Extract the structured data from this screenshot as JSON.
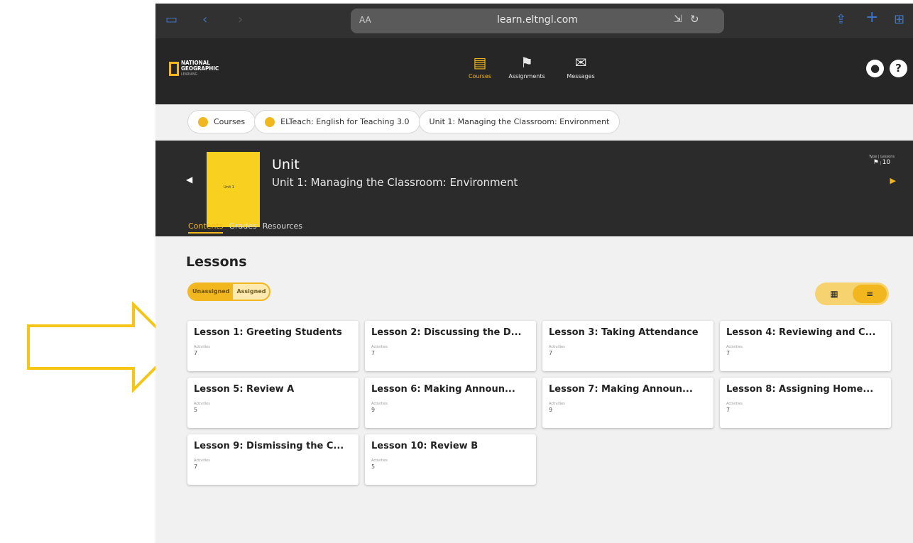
{
  "browser": {
    "url": "learn.eltngl.com",
    "aa_label": "AA"
  },
  "header": {
    "logo_line1": "NATIONAL",
    "logo_line2": "GEOGRAPHIC",
    "logo_line3": "LEARNING",
    "nav": [
      {
        "label": "Courses",
        "icon": "course-book-icon"
      },
      {
        "label": "Assignments",
        "icon": "assignment-flag-icon"
      },
      {
        "label": "Messages",
        "icon": "envelope-icon"
      }
    ],
    "accent": "#f2b71f"
  },
  "breadcrumb": {
    "items": [
      {
        "label": "Courses"
      },
      {
        "label": "ELTeach: English for Teaching 3.0"
      },
      {
        "label": "Unit 1: Managing the Classroom: Environment"
      }
    ]
  },
  "unit": {
    "type_label": "Unit",
    "title": "Unit 1: Managing the Classroom: Environment",
    "cover_text": "Unit 1",
    "meta_type_label": "Type",
    "meta_lessons_label": "Lessons",
    "meta_lessons_value": "10",
    "tabs": [
      "Contents",
      "Grades",
      "Resources"
    ]
  },
  "main": {
    "heading": "Lessons",
    "filter": [
      "Unassigned",
      "Assigned"
    ],
    "activities_label": "Activities",
    "lessons": [
      {
        "title": "Lesson 1: Greeting Students",
        "activities": "7"
      },
      {
        "title": "Lesson 2: Discussing the D...",
        "activities": "7"
      },
      {
        "title": "Lesson 3: Taking Attendance",
        "activities": "7"
      },
      {
        "title": "Lesson 4: Reviewing and C...",
        "activities": "7"
      },
      {
        "title": "Lesson 5: Review A",
        "activities": "5"
      },
      {
        "title": "Lesson 6: Making Announ...",
        "activities": "9"
      },
      {
        "title": "Lesson 7: Making Announ...",
        "activities": "9"
      },
      {
        "title": "Lesson 8: Assigning Home...",
        "activities": "7"
      },
      {
        "title": "Lesson 9: Dismissing the C...",
        "activities": "7"
      },
      {
        "title": "Lesson 10: Review B",
        "activities": "5"
      }
    ]
  }
}
